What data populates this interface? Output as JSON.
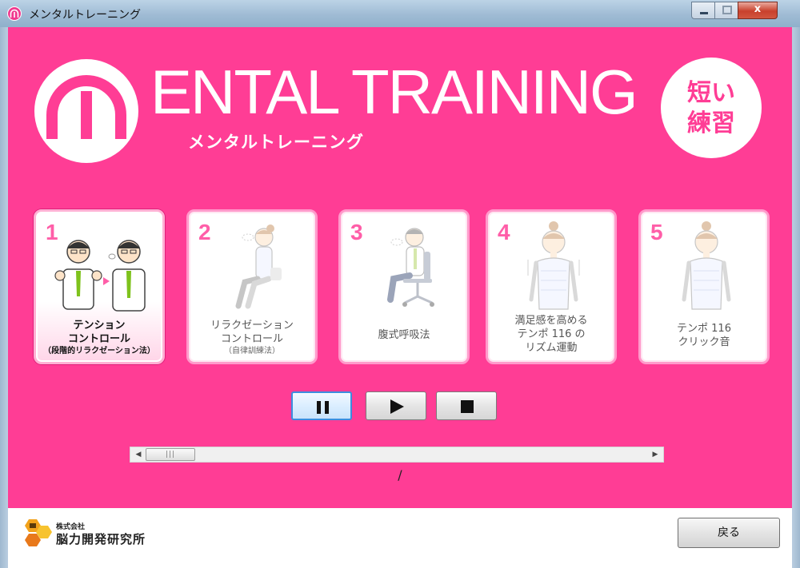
{
  "window": {
    "title": "メンタルトレーニング",
    "close_glyph": "x"
  },
  "logo": {
    "text": "ENTAL TRAINING",
    "subtitle": "メンタルトレーニング"
  },
  "badge": {
    "line1": "短い",
    "line2": "練習"
  },
  "cards": [
    {
      "number": "1",
      "lines": [
        "テンション",
        "コントロール"
      ],
      "sub": "（段階的リラクゼーション法）",
      "active": true
    },
    {
      "number": "2",
      "lines": [
        "リラクゼーション",
        "コントロール"
      ],
      "sub": "（自律訓練法）",
      "active": false
    },
    {
      "number": "3",
      "lines": [
        "腹式呼吸法"
      ],
      "sub": "",
      "active": false
    },
    {
      "number": "4",
      "lines": [
        "満足感を高める",
        "テンポ 116 の",
        "リズム運動"
      ],
      "sub": "",
      "active": false
    },
    {
      "number": "5",
      "lines": [
        "テンポ 116",
        "クリック音"
      ],
      "sub": "",
      "active": false
    }
  ],
  "transport": {
    "buttons": [
      "pause",
      "play",
      "stop"
    ],
    "selected": "pause"
  },
  "seek": {
    "time_text": "/"
  },
  "footer": {
    "company_small": "株式会社",
    "company_name": "脳力開発研究所",
    "back_label": "戻る"
  },
  "colors": {
    "primary": "#ff3d95",
    "card_border": "#ff9acb",
    "number": "#ff5ea8"
  }
}
